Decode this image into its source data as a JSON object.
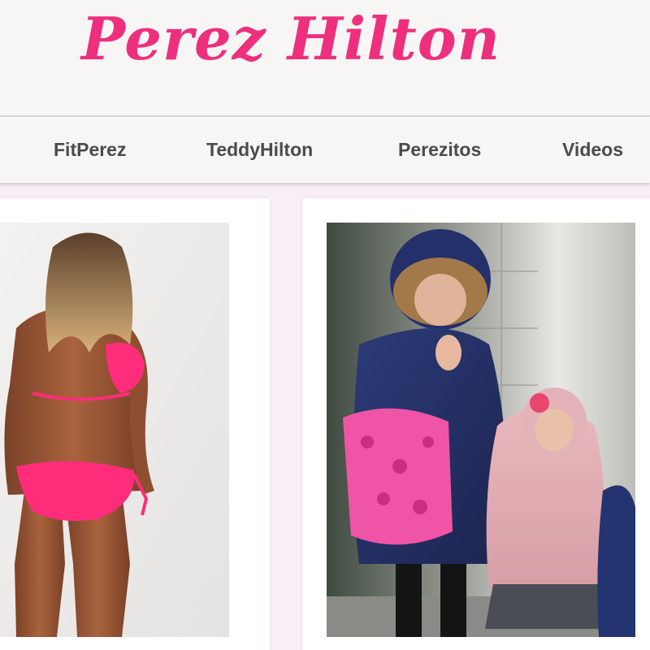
{
  "header": {
    "logo_text": "Perez Hilton",
    "brand_color": "#ee2f7d"
  },
  "nav": {
    "items": [
      {
        "label": "FitPerez"
      },
      {
        "label": "TeddyHilton"
      },
      {
        "label": "Perezitos"
      },
      {
        "label": "Videos"
      }
    ]
  },
  "posts": [
    {
      "image_icon": "woman-in-pink-bikini-photo"
    },
    {
      "image_icon": "mother-and-daughter-in-winter-coats-photo"
    }
  ],
  "colors": {
    "page_background": "#f8eef5",
    "header_background": "#f7f6f4",
    "nav_text": "#4b4b4b"
  }
}
